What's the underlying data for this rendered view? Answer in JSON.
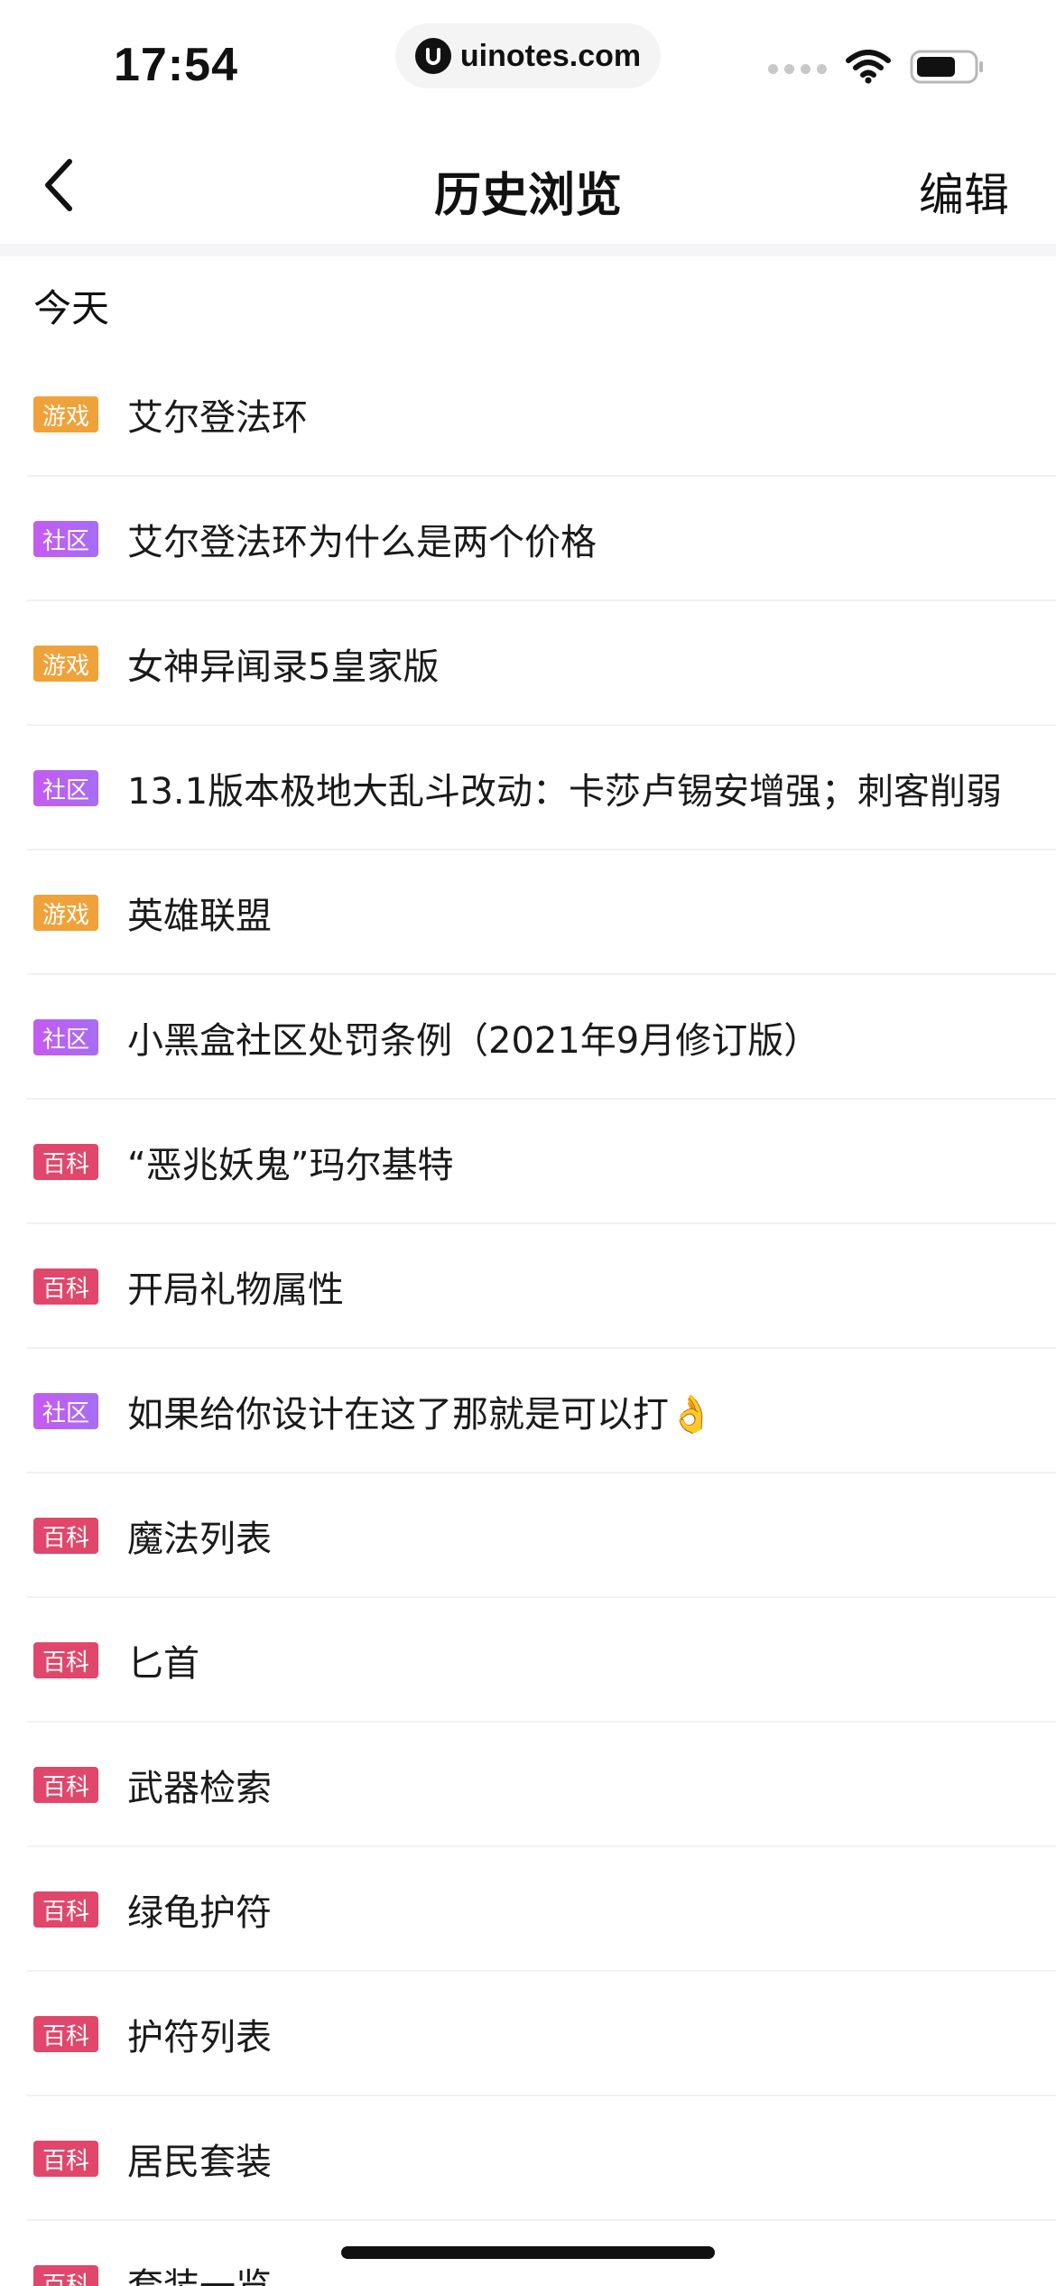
{
  "status_bar": {
    "time": "17:54",
    "url": "uinotes.com"
  },
  "nav": {
    "title": "历史浏览",
    "edit_label": "编辑"
  },
  "section_label": "今天",
  "tag_colors": {
    "game": "#f0a23a",
    "community": "#b563f2",
    "wiki": "#e0476b"
  },
  "items": [
    {
      "type": "game",
      "tag": "游戏",
      "title": "艾尔登法环"
    },
    {
      "type": "community",
      "tag": "社区",
      "title": "艾尔登法环为什么是两个价格"
    },
    {
      "type": "game",
      "tag": "游戏",
      "title": "女神异闻录5皇家版"
    },
    {
      "type": "community",
      "tag": "社区",
      "title": "13.1版本极地大乱斗改动：卡莎卢锡安增强；刺客削弱"
    },
    {
      "type": "game",
      "tag": "游戏",
      "title": "英雄联盟"
    },
    {
      "type": "community",
      "tag": "社区",
      "title": "小黑盒社区处罚条例（2021年9月修订版）"
    },
    {
      "type": "wiki",
      "tag": "百科",
      "title": "“恶兆妖鬼”玛尔基特"
    },
    {
      "type": "wiki",
      "tag": "百科",
      "title": "开局礼物属性"
    },
    {
      "type": "community",
      "tag": "社区",
      "title": "如果给你设计在这了那就是可以打👌"
    },
    {
      "type": "wiki",
      "tag": "百科",
      "title": "魔法列表"
    },
    {
      "type": "wiki",
      "tag": "百科",
      "title": "匕首"
    },
    {
      "type": "wiki",
      "tag": "百科",
      "title": "武器检索"
    },
    {
      "type": "wiki",
      "tag": "百科",
      "title": "绿龟护符"
    },
    {
      "type": "wiki",
      "tag": "百科",
      "title": "护符列表"
    },
    {
      "type": "wiki",
      "tag": "百科",
      "title": "居民套装"
    },
    {
      "type": "wiki",
      "tag": "百科",
      "title": "套装一览"
    }
  ]
}
